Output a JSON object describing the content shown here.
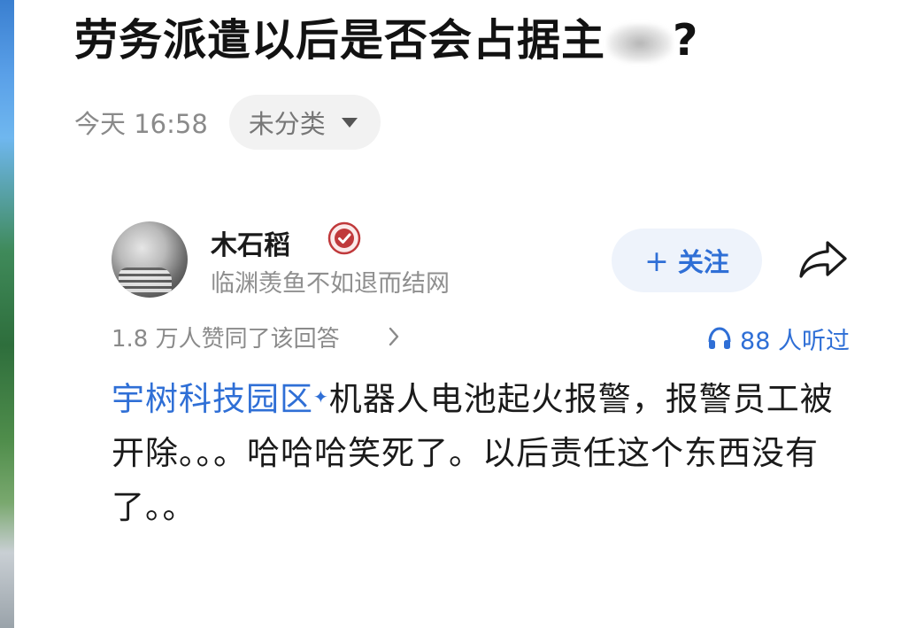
{
  "question": {
    "title": "劳务派遣以后是否会占据主",
    "title_obscured_suffix": "?"
  },
  "meta": {
    "time": "今天 16:58",
    "category": "未分类"
  },
  "author": {
    "name": "木石稻",
    "bio": "临渊羡鱼不如退而结网",
    "follow_label": "关注",
    "follow_icon": "plus-icon",
    "share_icon": "share-icon",
    "badge_icon": "verified-badge-icon"
  },
  "stats": {
    "likes": "1.8 万人赞同了该回答",
    "listen": "88 人听过"
  },
  "answer": {
    "link_text": "宇树科技园区",
    "text": "机器人电池起火报警，报警员工被开除。。。哈哈哈笑死了。以后责任这个东西没有了。。"
  },
  "colors": {
    "accent": "#2f6fd6",
    "follow_bg": "#eef3fb",
    "badge": "#c0393b"
  }
}
